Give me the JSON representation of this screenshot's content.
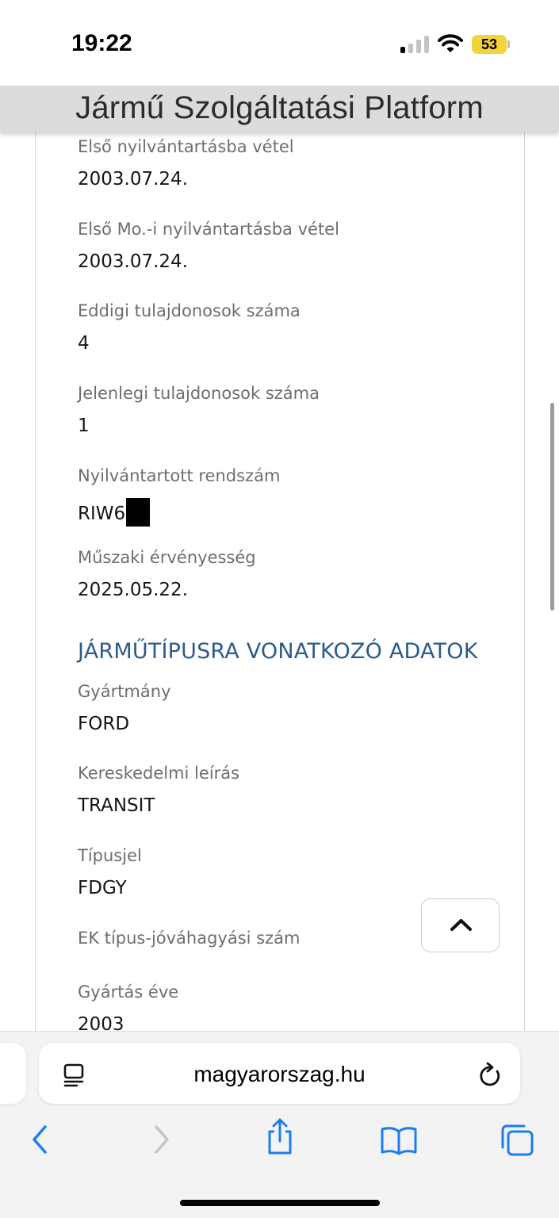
{
  "status_bar": {
    "time": "19:22",
    "battery": "53"
  },
  "header": {
    "title": "Jármű Szolgáltatási Platform"
  },
  "fields_top": [
    {
      "label": "Első nyilvántartásba vétel",
      "value": "2003.07.24."
    },
    {
      "label": "Első Mo.-i nyilvántartásba vétel",
      "value": "2003.07.24."
    },
    {
      "label": "Eddigi tulajdonosok száma",
      "value": "4"
    },
    {
      "label": "Jelenlegi tulajdonosok száma",
      "value": "1"
    },
    {
      "label": "Nyilvántartott rendszám",
      "value": "RIW6"
    },
    {
      "label": "Műszaki érvényesség",
      "value": "2025.05.22."
    }
  ],
  "section_vehicle_type": {
    "heading": "JÁRMŰTÍPUSRA VONATKOZÓ ADATOK",
    "fields": [
      {
        "label": "Gyártmány",
        "value": "FORD"
      },
      {
        "label": "Kereskedelmi leírás",
        "value": "TRANSIT"
      },
      {
        "label": "Típusjel",
        "value": "FDGY"
      },
      {
        "label": "EK típus-jóváhagyási szám",
        "value": ""
      },
      {
        "label": "Gyártás éve",
        "value": "2003"
      }
    ]
  },
  "browser": {
    "url": "magyarorszag.hu"
  },
  "colors": {
    "heading": "#2d5b8c",
    "label": "#6e6e6e",
    "accent_blue": "#1a7cf5",
    "battery": "#f2d43a"
  },
  "icons": [
    "signal-icon",
    "wifi-icon",
    "battery-icon",
    "chevron-up-icon",
    "reader-icon",
    "reload-icon",
    "back-icon",
    "forward-icon",
    "share-icon",
    "bookmarks-icon",
    "tabs-icon"
  ]
}
